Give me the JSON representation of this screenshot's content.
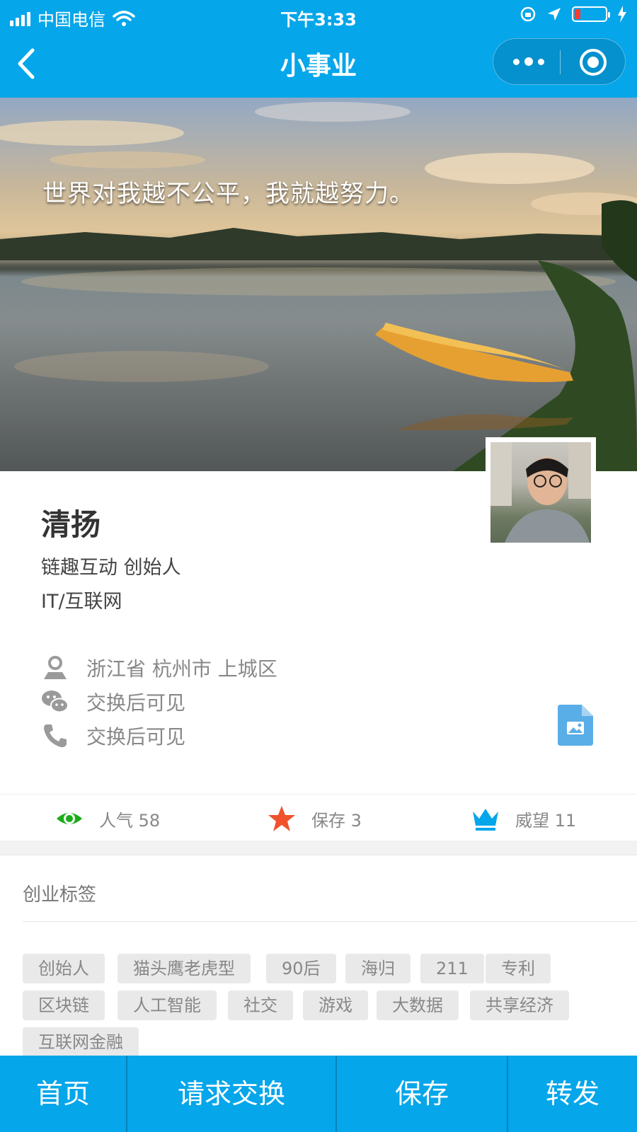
{
  "status_bar": {
    "carrier": "中国电信",
    "time": "下午3:33"
  },
  "nav": {
    "title": "小事业"
  },
  "hero": {
    "quote": "世界对我越不公平，我就越努力。"
  },
  "profile": {
    "name": "清扬",
    "title": "链趣互动 创始人",
    "industry": "IT/互联网"
  },
  "contact": {
    "location": "浙江省 杭州市 上城区",
    "wechat": "交换后可见",
    "phone": "交换后可见"
  },
  "stats": {
    "popularity": "人气 58",
    "saved": "保存 3",
    "prestige": "威望 11"
  },
  "tags_section": {
    "title": "创业标签",
    "tags": [
      "创始人",
      "猫头鹰老虎型",
      "90后",
      "海归",
      "211",
      "专利",
      "区块链",
      "人工智能",
      "社交",
      "游戏",
      "大数据",
      "共享经济",
      "互联网金融"
    ]
  },
  "bottom_bar": {
    "home": "首页",
    "request_exchange": "请求交换",
    "save": "保存",
    "forward": "转发"
  },
  "colors": {
    "primary": "#05a6ea",
    "eye": "#1aad19",
    "star": "#f0522d",
    "crown": "#05a6ea"
  }
}
